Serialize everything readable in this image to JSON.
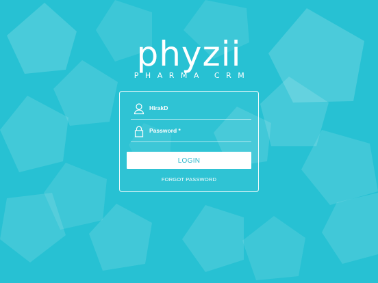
{
  "brand": {
    "name": "phyzii",
    "tagline": "PHARMA CRM"
  },
  "form": {
    "username_value": "HirakD",
    "password_placeholder": "Password *",
    "login_label": "LOGIN",
    "forgot_label": "FORGOT PASSWORD"
  },
  "icons": {
    "username": "user-icon",
    "password": "lock-icon"
  },
  "colors": {
    "background": "#27c1d3",
    "button": "#ffffff",
    "button_text": "#2bb7cc",
    "text": "#ffffff"
  }
}
